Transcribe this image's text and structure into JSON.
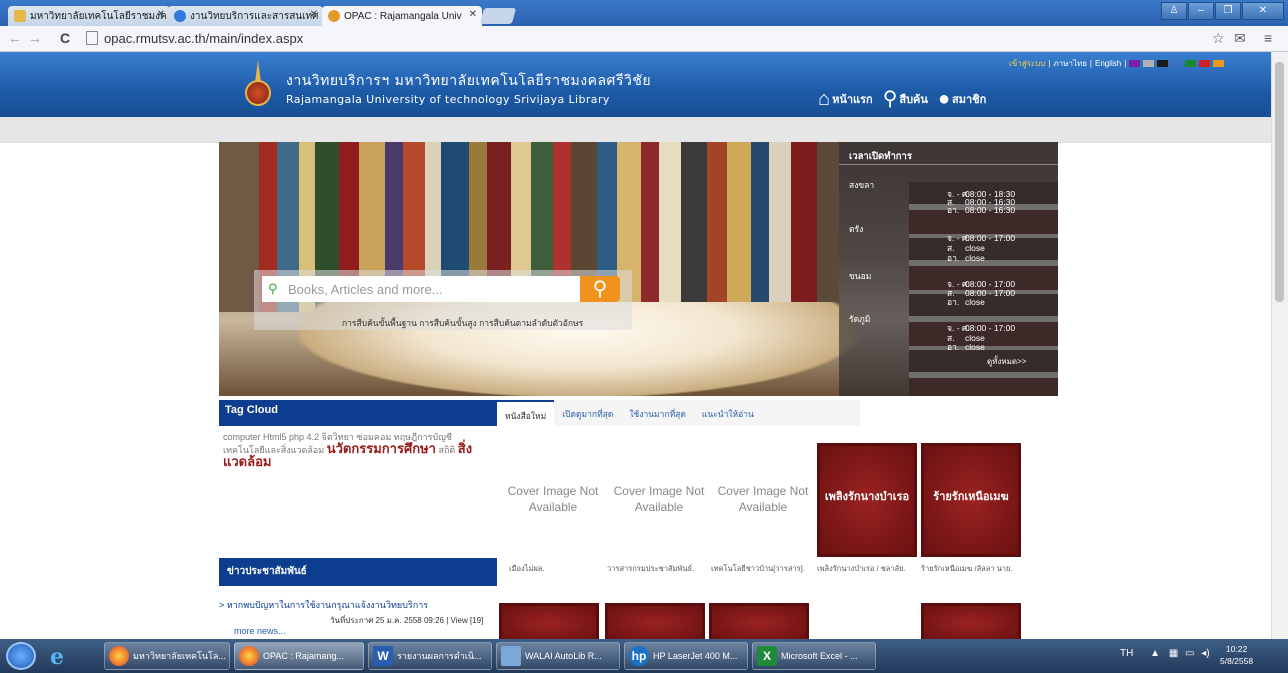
{
  "browser": {
    "tabs": [
      {
        "title": "มหาวิทยาลัยเทคโนโลยีราชมงค"
      },
      {
        "title": "งานวิทยบริการและสารสนเทศ"
      },
      {
        "title": "OPAC : Rajamangala Univ"
      }
    ],
    "url": "opac.rmutsv.ac.th/main/index.aspx"
  },
  "header": {
    "title_th": "งานวิทยบริการฯ มหาวิทยาลัยเทคโนโลยีราชมงคลศรีวิชัย",
    "title_en": "Rajamangala University of technology Srivijaya Library",
    "toplinks": {
      "login": "เข้าสู่ระบบ",
      "sep1": "|",
      "thai": "ภาษาไทย",
      "sep2": "|",
      "english": "English",
      "sep3": "|"
    },
    "theme_colors": [
      "#7a1fa2",
      "#b0b0b0",
      "#1a1a1a",
      "#3a6fc4",
      "#1b8a2e",
      "#d42020",
      "#e89a1a"
    ],
    "nav": [
      {
        "label": "หน้าแรก",
        "icon": "home-icon"
      },
      {
        "label": "สืบค้น",
        "icon": "search-icon"
      },
      {
        "label": "สมาชิก",
        "icon": "user-icon"
      }
    ]
  },
  "search": {
    "placeholder": "Books, Articles and more...",
    "links": "การสืบค้นขั้นพื้นฐาน  การสืบค้นขั้นสูง  การสืบค้นตามลำดับตัวอักษร"
  },
  "hours": {
    "title": "เวลาเปิดทำการ",
    "branches": [
      {
        "name": "สงขลา",
        "rows": [
          [
            "จ. - ศ.",
            "08:00 - 18:30"
          ],
          [
            "ส.",
            "08:00 - 16:30"
          ],
          [
            "อา.",
            "08:00 - 16:30"
          ]
        ]
      },
      {
        "name": "ตรัง",
        "rows": [
          [
            "จ. - ศ.",
            "08:00 - 17:00"
          ],
          [
            "ส.",
            "close"
          ],
          [
            "อา.",
            "close"
          ]
        ]
      },
      {
        "name": "ขนอม",
        "rows": [
          [
            "จ. - ศ.",
            "08:00 - 17:00"
          ],
          [
            "ส.",
            "08:00 - 17:00"
          ],
          [
            "อา.",
            "close"
          ]
        ]
      },
      {
        "name": "รัตภูมิ",
        "rows": [
          [
            "จ. - ศ.",
            "08:00 - 17:00"
          ],
          [
            "ส.",
            "close"
          ],
          [
            "อา.",
            "close"
          ]
        ]
      }
    ],
    "see_all": "ดูทั้งหมด>>"
  },
  "tagcloud": {
    "title": "Tag Cloud",
    "small_tags": "computer Html5 php 4.2 จิตวิทยา ซ่อมคอม ทฤษฎีการบัญชี เทคโนโลยีและสิ่งแวดล้อม",
    "big_tag": "นวัตกรรมการศึกษา",
    "tag_stat": "สถิติ",
    "tag_env": "สิ่งแวดล้อม"
  },
  "tabs": [
    "หนังสือใหม่",
    "เปิดดูมากที่สุด",
    "ใช้งานมากที่สุด",
    "แนะนำให้อ่าน"
  ],
  "books": [
    {
      "cover": "Cover Image Not Available",
      "caption": "เมืองไม่ผล."
    },
    {
      "cover": "Cover Image Not Available",
      "caption": "วารสารกรมประชาสัมพันธ์."
    },
    {
      "cover": "Cover Image Not Available",
      "caption": "เทคโนโลยีชาวบ้าน[วารสาร]."
    },
    {
      "cover": "เพลิงรักนางบำเรอ",
      "caption": "เพลิงรักนางบำเรอ / ชลาลัย."
    },
    {
      "cover": "ร้ายรักเหนือเมฆ",
      "caption": "ร้ายรักเหนือเมฆ /ลัลลา นาย."
    }
  ],
  "news": {
    "title": "ข่าวประชาสัมพันธ์",
    "item": "> หากพบปัญหาในการใช้งานกรุณาแจ้งงานวิทยบริการ",
    "meta": "วันที่ประกาศ 25 ม.ค. 2558 09:26 | View [19]",
    "more": "more news..."
  },
  "taskbar": {
    "items": [
      "มหาวิทยาลัยเทคโนโล...",
      "OPAC : Rajamang...",
      "รายงานผลการดำเนิ...",
      "WALAI AutoLib R...",
      "HP LaserJet 400 M...",
      "Microsoft Excel - ..."
    ],
    "lang": "TH",
    "time": "10:22",
    "date": "5/8/2558"
  }
}
